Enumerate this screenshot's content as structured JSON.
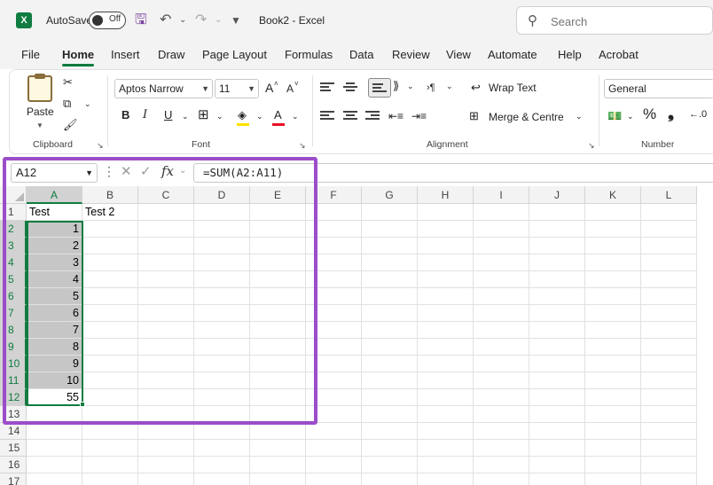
{
  "titlebar": {
    "app_logo": "X",
    "autosave_label": "AutoSave",
    "autosave_state": "Off",
    "document_title": "Book2  -  Excel",
    "search_placeholder": "Search"
  },
  "menu_tabs": [
    "File",
    "Home",
    "Insert",
    "Draw",
    "Page Layout",
    "Formulas",
    "Data",
    "Review",
    "View",
    "Automate",
    "Help",
    "Acrobat"
  ],
  "active_tab": "Home",
  "ribbon": {
    "clipboard": {
      "label": "Clipboard",
      "paste_label": "Paste"
    },
    "font": {
      "label": "Font",
      "font_name": "Aptos Narrow",
      "font_size": "11",
      "grow_font": "A",
      "shrink_font": "A",
      "bold": "B",
      "italic": "I",
      "underline": "U",
      "font_color_letter": "A"
    },
    "alignment": {
      "label": "Alignment",
      "wrap_text": "Wrap Text",
      "merge_centre": "Merge & Centre"
    },
    "number": {
      "label": "Number",
      "format": "General",
      "percent": "%",
      "comma": "❟"
    }
  },
  "formula_bar": {
    "name_box": "A12",
    "fx": "fx",
    "formula": "=SUM(A2:A11)"
  },
  "sheet": {
    "columns": [
      "A",
      "B",
      "C",
      "D",
      "E",
      "F",
      "G",
      "H",
      "I",
      "J",
      "K",
      "L"
    ],
    "rows": [
      "1",
      "2",
      "3",
      "4",
      "5",
      "6",
      "7",
      "8",
      "9",
      "10",
      "11",
      "12",
      "13",
      "14",
      "15",
      "16",
      "17"
    ],
    "cells": {
      "A1": "Test",
      "B1": "Test 2",
      "A2": "1",
      "A3": "2",
      "A4": "3",
      "A5": "4",
      "A6": "5",
      "A7": "6",
      "A8": "7",
      "A9": "8",
      "A10": "9",
      "A11": "10",
      "A12": "55"
    },
    "selected_range": "A2:A12",
    "active_cell": "A12"
  },
  "colors": {
    "excel_green": "#107c41",
    "highlight_purple": "#9b4dca",
    "selection_fill": "#c6c6c6"
  }
}
